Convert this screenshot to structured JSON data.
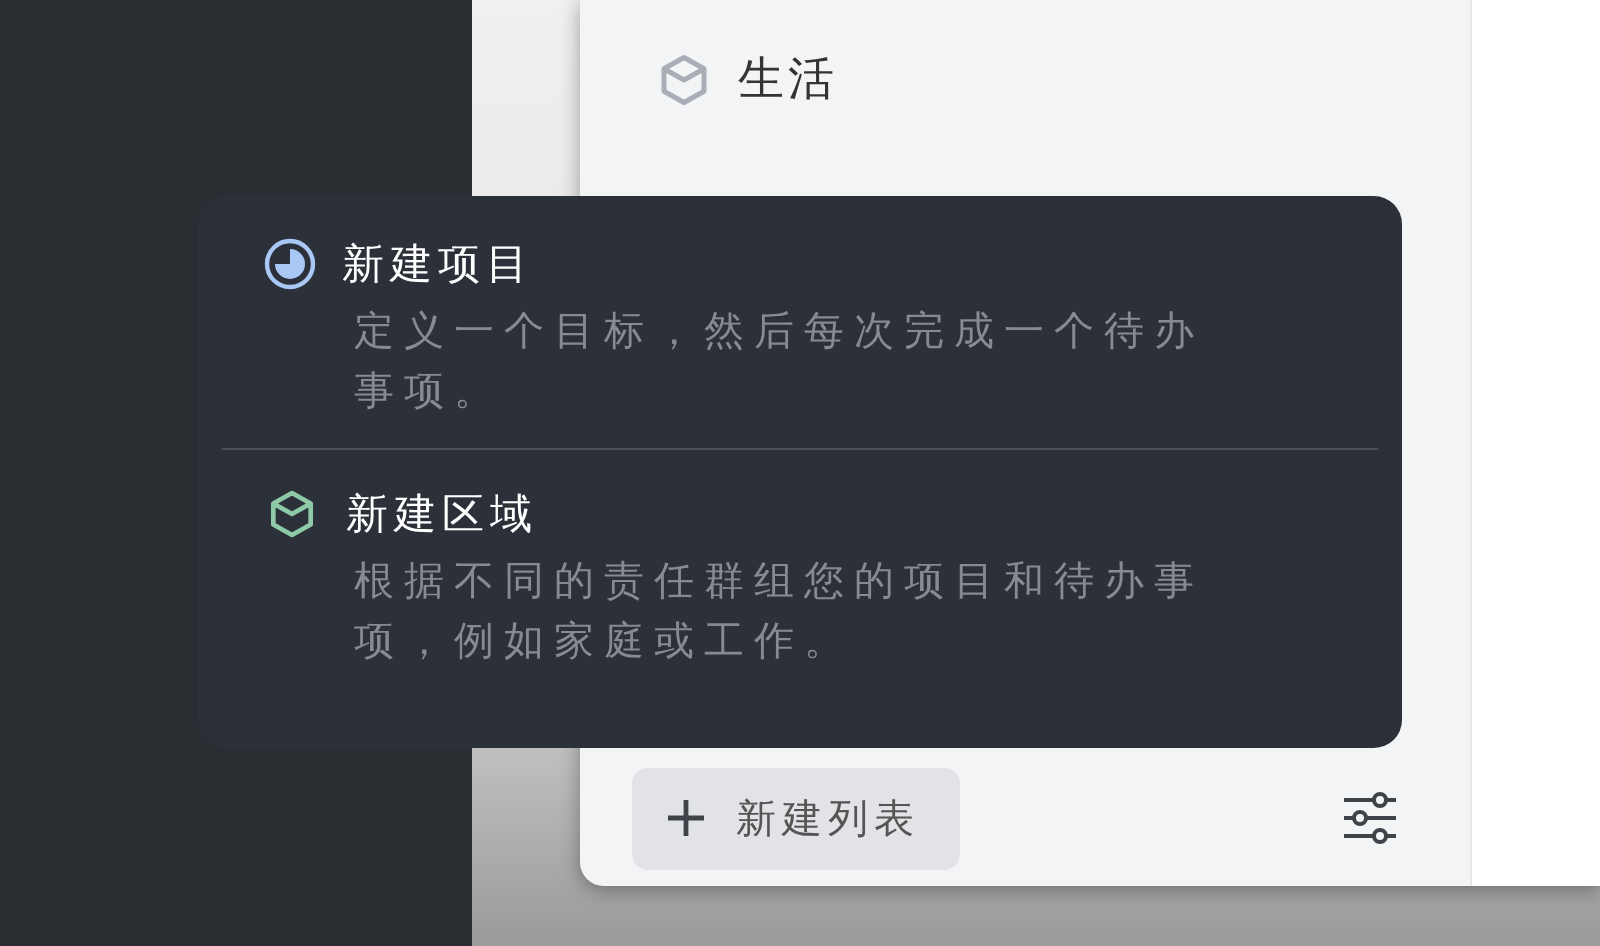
{
  "sidebar": {
    "items": [
      {
        "kind": "area",
        "label": "生活"
      }
    ]
  },
  "bottom_bar": {
    "new_list_button": {
      "label": "新建列表"
    }
  },
  "menu": {
    "items": [
      {
        "kind": "project",
        "title": "新建项目",
        "description": "定义一个目标，然后每次完成一个待办事项。"
      },
      {
        "kind": "area",
        "title": "新建区域",
        "description": "根据不同的责任群组您的项目和待办事项，例如家庭或工作。"
      }
    ]
  }
}
